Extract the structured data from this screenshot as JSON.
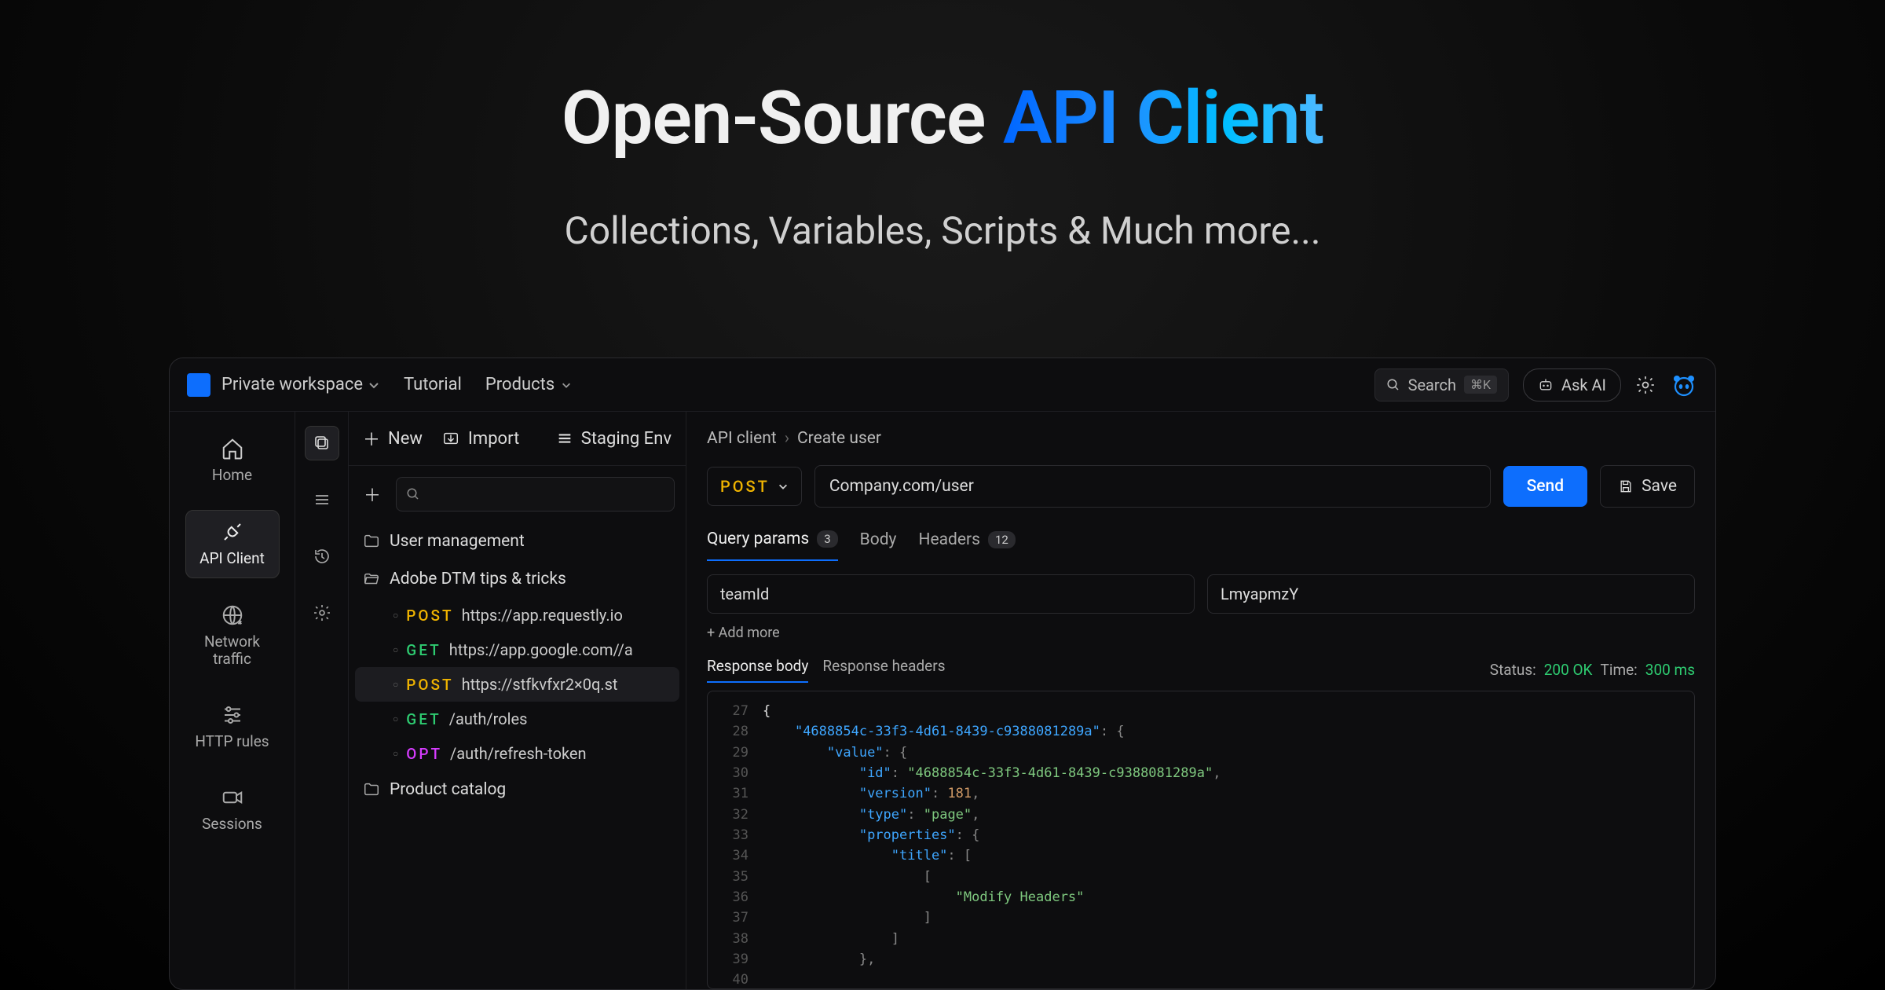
{
  "hero": {
    "title_plain": "Open-Source ",
    "title_gradient": "API Client",
    "subtitle": "Collections, Variables, Scripts & Much more..."
  },
  "topbar": {
    "workspace": "Private workspace",
    "links": [
      "Tutorial",
      "Products"
    ],
    "search_label": "Search",
    "search_kbd": "⌘K",
    "askai_label": "Ask AI"
  },
  "nav": [
    {
      "key": "home",
      "label": "Home"
    },
    {
      "key": "api-client",
      "label": "API Client"
    },
    {
      "key": "network-traffic",
      "label": "Network traffic"
    },
    {
      "key": "http-rules",
      "label": "HTTP rules"
    },
    {
      "key": "sessions",
      "label": "Sessions"
    }
  ],
  "sidebar": {
    "new_label": "New",
    "import_label": "Import",
    "env_label": "Staging Env",
    "folders": [
      {
        "type": "folder",
        "label": "User management"
      },
      {
        "type": "folder-open",
        "label": "Adobe DTM tips & tricks"
      }
    ],
    "requests": [
      {
        "method": "POST",
        "cls": "m-post",
        "url": "https://app.requestly.io"
      },
      {
        "method": "GET",
        "cls": "m-get",
        "url": "https://app.google.com//a"
      },
      {
        "method": "POST",
        "cls": "m-post",
        "url": "https://stfkvfxr2×0q.st",
        "selected": true
      },
      {
        "method": "GET",
        "cls": "m-get",
        "url": "/auth/roles"
      },
      {
        "method": "OPT",
        "cls": "m-opt",
        "url": "/auth/refresh-token"
      }
    ],
    "folder_after": "Product catalog"
  },
  "main": {
    "breadcrumb": [
      "API client",
      "Create user"
    ],
    "method": "POST",
    "url": "Company.com/user",
    "send": "Send",
    "save": "Save",
    "tabs": [
      {
        "label": "Query params",
        "badge": "3",
        "active": true
      },
      {
        "label": "Body"
      },
      {
        "label": "Headers",
        "badge": "12"
      }
    ],
    "param_key": "teamId",
    "param_value": "LmyapmzY",
    "add_more": "+  Add more",
    "resp_tabs": [
      {
        "label": "Response body",
        "active": true
      },
      {
        "label": "Response headers"
      }
    ],
    "status_label": "Status:",
    "status_value": "200 OK",
    "time_label": "Time:",
    "time_value": "300 ms",
    "code_lines": [
      {
        "n": "27",
        "html": "{"
      },
      {
        "n": "28",
        "html": "  <span class='k'>\"4688854c-33f3-4d61-8439-c9388081289a\"</span><span class='p'>: {</span>"
      },
      {
        "n": "29",
        "html": "    <span class='k'>\"value\"</span><span class='p'>: {</span>"
      },
      {
        "n": "30",
        "html": "      <span class='k'>\"id\"</span><span class='p'>: </span><span class='s'>\"4688854c-33f3-4d61-8439-c9388081289a\"</span><span class='p'>,</span>"
      },
      {
        "n": "31",
        "html": "      <span class='k'>\"version\"</span><span class='p'>: </span><span class='n'>181</span><span class='p'>,</span>"
      },
      {
        "n": "32",
        "html": "      <span class='k'>\"type\"</span><span class='p'>: </span><span class='s'>\"page\"</span><span class='p'>,</span>"
      },
      {
        "n": "33",
        "html": "      <span class='k'>\"properties\"</span><span class='p'>: {</span>"
      },
      {
        "n": "34",
        "html": "        <span class='k'>\"title\"</span><span class='p'>: [</span>"
      },
      {
        "n": "35",
        "html": "          <span class='p'>[</span>"
      },
      {
        "n": "36",
        "html": "            <span class='s'>\"Modify Headers\"</span>"
      },
      {
        "n": "37",
        "html": "          <span class='p'>]</span>"
      },
      {
        "n": "38",
        "html": "        <span class='p'>]</span>"
      },
      {
        "n": "39",
        "html": "      <span class='p'>},</span>"
      },
      {
        "n": "40",
        "html": ""
      }
    ]
  }
}
